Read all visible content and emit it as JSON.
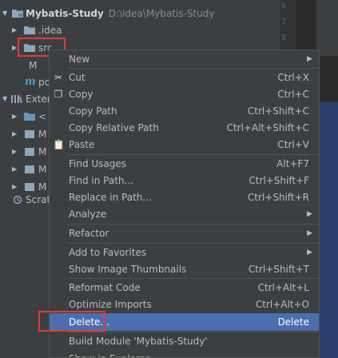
{
  "project_tree": {
    "root_name": "Mybatis-Study",
    "root_path": "D:\\idea\\Mybatis-Study",
    "idea_folder": ".idea",
    "src_folder": "src",
    "m_item_1": "M",
    "m_item_2_label": "po",
    "external_label": "Exter",
    "lib_labels": [
      "<",
      "M",
      "M",
      "M",
      "M"
    ],
    "scratches_label": "Scrat"
  },
  "editor": {
    "line_numbers": [
      "6",
      "7",
      "8"
    ]
  },
  "context_menu": {
    "items": [
      {
        "label": "New",
        "shortcut": "",
        "submenu": true,
        "icon": ""
      },
      {
        "label": "Cut",
        "shortcut": "Ctrl+X",
        "submenu": false,
        "icon": "scissors-icon"
      },
      {
        "label": "Copy",
        "shortcut": "Ctrl+C",
        "submenu": false,
        "icon": "copy-icon"
      },
      {
        "label": "Copy Path",
        "shortcut": "Ctrl+Shift+C",
        "submenu": false,
        "icon": ""
      },
      {
        "label": "Copy Relative Path",
        "shortcut": "Ctrl+Alt+Shift+C",
        "submenu": false,
        "icon": ""
      },
      {
        "label": "Paste",
        "shortcut": "Ctrl+V",
        "submenu": false,
        "icon": "clipboard-icon"
      },
      {
        "label": "Find Usages",
        "shortcut": "Alt+F7",
        "submenu": false,
        "icon": ""
      },
      {
        "label": "Find in Path...",
        "shortcut": "Ctrl+Shift+F",
        "submenu": false,
        "icon": ""
      },
      {
        "label": "Replace in Path...",
        "shortcut": "Ctrl+Shift+R",
        "submenu": false,
        "icon": ""
      },
      {
        "label": "Analyze",
        "shortcut": "",
        "submenu": true,
        "icon": ""
      },
      {
        "label": "Refactor",
        "shortcut": "",
        "submenu": true,
        "icon": ""
      },
      {
        "label": "Add to Favorites",
        "shortcut": "",
        "submenu": true,
        "icon": ""
      },
      {
        "label": "Show Image Thumbnails",
        "shortcut": "Ctrl+Shift+T",
        "submenu": false,
        "icon": ""
      },
      {
        "label": "Reformat Code",
        "shortcut": "Ctrl+Alt+L",
        "submenu": false,
        "icon": ""
      },
      {
        "label": "Optimize Imports",
        "shortcut": "Ctrl+Alt+O",
        "submenu": false,
        "icon": ""
      },
      {
        "label": "Delete...",
        "shortcut": "Delete",
        "submenu": false,
        "icon": "",
        "selected": true
      },
      {
        "label": "Build Module 'Mybatis-Study'",
        "shortcut": "",
        "submenu": false,
        "icon": ""
      },
      {
        "label": "Show in Explorer",
        "shortcut": "",
        "submenu": false,
        "icon": ""
      }
    ]
  },
  "colors": {
    "background": "#3c3f41",
    "selection": "#4b6eaf",
    "highlight_box": "#e53935",
    "folder": "#8fa6bc"
  }
}
